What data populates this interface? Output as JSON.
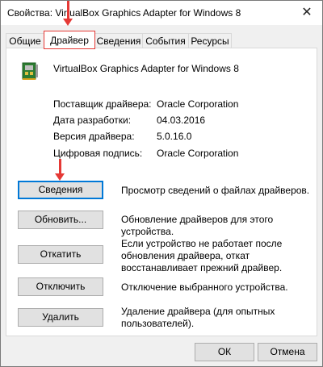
{
  "window": {
    "title": "Свойства: VirtualBox Graphics Adapter for Windows 8",
    "close_glyph": "✕"
  },
  "tabs": [
    {
      "label": "Общие"
    },
    {
      "label": "Драйвер"
    },
    {
      "label": "Сведения"
    },
    {
      "label": "События"
    },
    {
      "label": "Ресурсы"
    }
  ],
  "device": {
    "name": "VirtualBox Graphics Adapter for Windows 8",
    "icon": "display-adapter-icon"
  },
  "properties": [
    {
      "label": "Поставщик драйвера:",
      "value": "Oracle Corporation"
    },
    {
      "label": "Дата разработки:",
      "value": "04.03.2016"
    },
    {
      "label": "Версия драйвера:",
      "value": "5.0.16.0"
    },
    {
      "label": "Цифровая подпись:",
      "value": "Oracle Corporation"
    }
  ],
  "actions": [
    {
      "label": "Сведения",
      "description": "Просмотр сведений о файлах драйверов."
    },
    {
      "label": "Обновить...",
      "description": "Обновление драйверов для этого устройства."
    },
    {
      "label": "Откатить",
      "description": "Если устройство не работает после обновления драйвера, откат восстанавливает прежний драйвер."
    },
    {
      "label": "Отключить",
      "description": "Отключение выбранного устройства."
    },
    {
      "label": "Удалить",
      "description": "Удаление драйвера (для опытных пользователей)."
    }
  ],
  "footer": {
    "ok_label": "ОК",
    "cancel_label": "Отмена"
  },
  "colors": {
    "annotation_red": "#e53935",
    "focus_blue": "#0078d7"
  }
}
